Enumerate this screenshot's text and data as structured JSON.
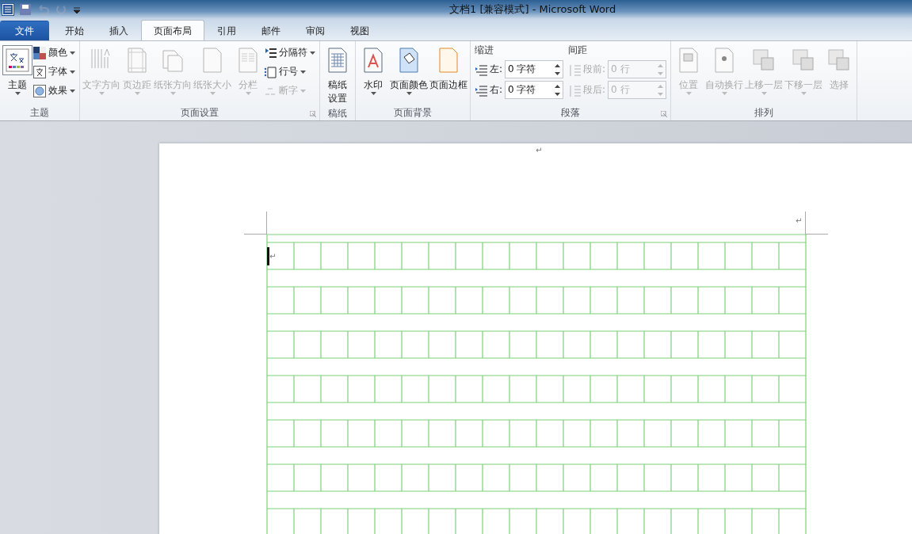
{
  "window": {
    "title": "文档1 [兼容模式]  -  Microsoft Word"
  },
  "quick_access": [
    {
      "disabled": false
    },
    {
      "disabled": false
    },
    {
      "disabled": true
    },
    {
      "disabled": true
    },
    {
      "disabled": false
    }
  ],
  "tabs": [
    {
      "label": "文件",
      "kind": "file",
      "selected": false
    },
    {
      "label": "开始",
      "kind": "tab",
      "selected": false
    },
    {
      "label": "插入",
      "kind": "tab",
      "selected": false
    },
    {
      "label": "页面布局",
      "kind": "tab",
      "selected": true
    },
    {
      "label": "引用",
      "kind": "tab",
      "selected": false
    },
    {
      "label": "邮件",
      "kind": "tab",
      "selected": false
    },
    {
      "label": "审阅",
      "kind": "tab",
      "selected": false
    },
    {
      "label": "视图",
      "kind": "tab",
      "selected": false
    }
  ],
  "ribbon": [
    {
      "label": "主题",
      "launcher": false,
      "items": [
        {
          "kind": "big",
          "label": "主题",
          "disabled": false,
          "dropdown": true,
          "framed": true
        },
        {
          "kind": "small_stack",
          "items": [
            {
              "label": "颜色",
              "disabled": false,
              "dropdown": true
            },
            {
              "label": "字体",
              "disabled": false,
              "dropdown": true
            },
            {
              "label": "效果",
              "disabled": false,
              "dropdown": true
            }
          ]
        }
      ]
    },
    {
      "label": "页面设置",
      "launcher": true,
      "items": [
        {
          "kind": "big",
          "label": "文字方向",
          "disabled": true,
          "dropdown": true,
          "framed": false
        },
        {
          "kind": "big",
          "label": "页边距",
          "disabled": true,
          "dropdown": true,
          "framed": false
        },
        {
          "kind": "big",
          "label": "纸张方向",
          "disabled": true,
          "dropdown": true,
          "framed": false
        },
        {
          "kind": "big",
          "label": "纸张大小",
          "disabled": true,
          "dropdown": true,
          "framed": false
        },
        {
          "kind": "big",
          "label": "分栏",
          "disabled": true,
          "dropdown": true,
          "framed": false
        },
        {
          "kind": "small_stack",
          "items": [
            {
              "label": "分隔符",
              "disabled": false,
              "dropdown": true
            },
            {
              "label": "行号",
              "disabled": false,
              "dropdown": true
            },
            {
              "label": "断字",
              "disabled": true,
              "dropdown": true
            }
          ]
        }
      ]
    },
    {
      "label": "稿纸",
      "launcher": false,
      "items": [
        {
          "kind": "big",
          "label": "稿纸设置",
          "disabled": false,
          "dropdown": false,
          "framed": false
        }
      ]
    },
    {
      "label": "页面背景",
      "launcher": false,
      "items": [
        {
          "kind": "big",
          "label": "水印",
          "disabled": false,
          "dropdown": true,
          "framed": false
        },
        {
          "kind": "big",
          "label": "页面颜色",
          "disabled": false,
          "dropdown": true,
          "framed": false
        },
        {
          "kind": "big",
          "label": "页面边框",
          "disabled": false,
          "dropdown": false,
          "framed": false
        }
      ]
    },
    {
      "label": "段落",
      "launcher": true,
      "items": [
        {
          "kind": "spin_group",
          "heading": "缩进",
          "fields": [
            {
              "label": "左:",
              "value": "0 字符",
              "disabled": false
            },
            {
              "label": "右:",
              "value": "0 字符",
              "disabled": false
            }
          ]
        },
        {
          "kind": "spin_group",
          "heading": "间距",
          "fields": [
            {
              "label": "段前:",
              "value": "0 行",
              "disabled": true
            },
            {
              "label": "段后:",
              "value": "0 行",
              "disabled": true
            }
          ]
        }
      ]
    },
    {
      "label": "排列",
      "launcher": false,
      "items": [
        {
          "kind": "big",
          "label": "位置",
          "disabled": true,
          "dropdown": true,
          "framed": false
        },
        {
          "kind": "big",
          "label": "自动换行",
          "disabled": true,
          "dropdown": true,
          "framed": false
        },
        {
          "kind": "big",
          "label": "上移一层",
          "disabled": true,
          "dropdown": true,
          "framed": false
        },
        {
          "kind": "big",
          "label": "下移一层",
          "disabled": true,
          "dropdown": true,
          "framed": false
        },
        {
          "kind": "big",
          "label": "选择",
          "disabled": true,
          "dropdown": false,
          "framed": false
        }
      ]
    }
  ],
  "document": {
    "top_mark": "↵",
    "header_mark": "↵",
    "cursor_mark": "↵"
  }
}
